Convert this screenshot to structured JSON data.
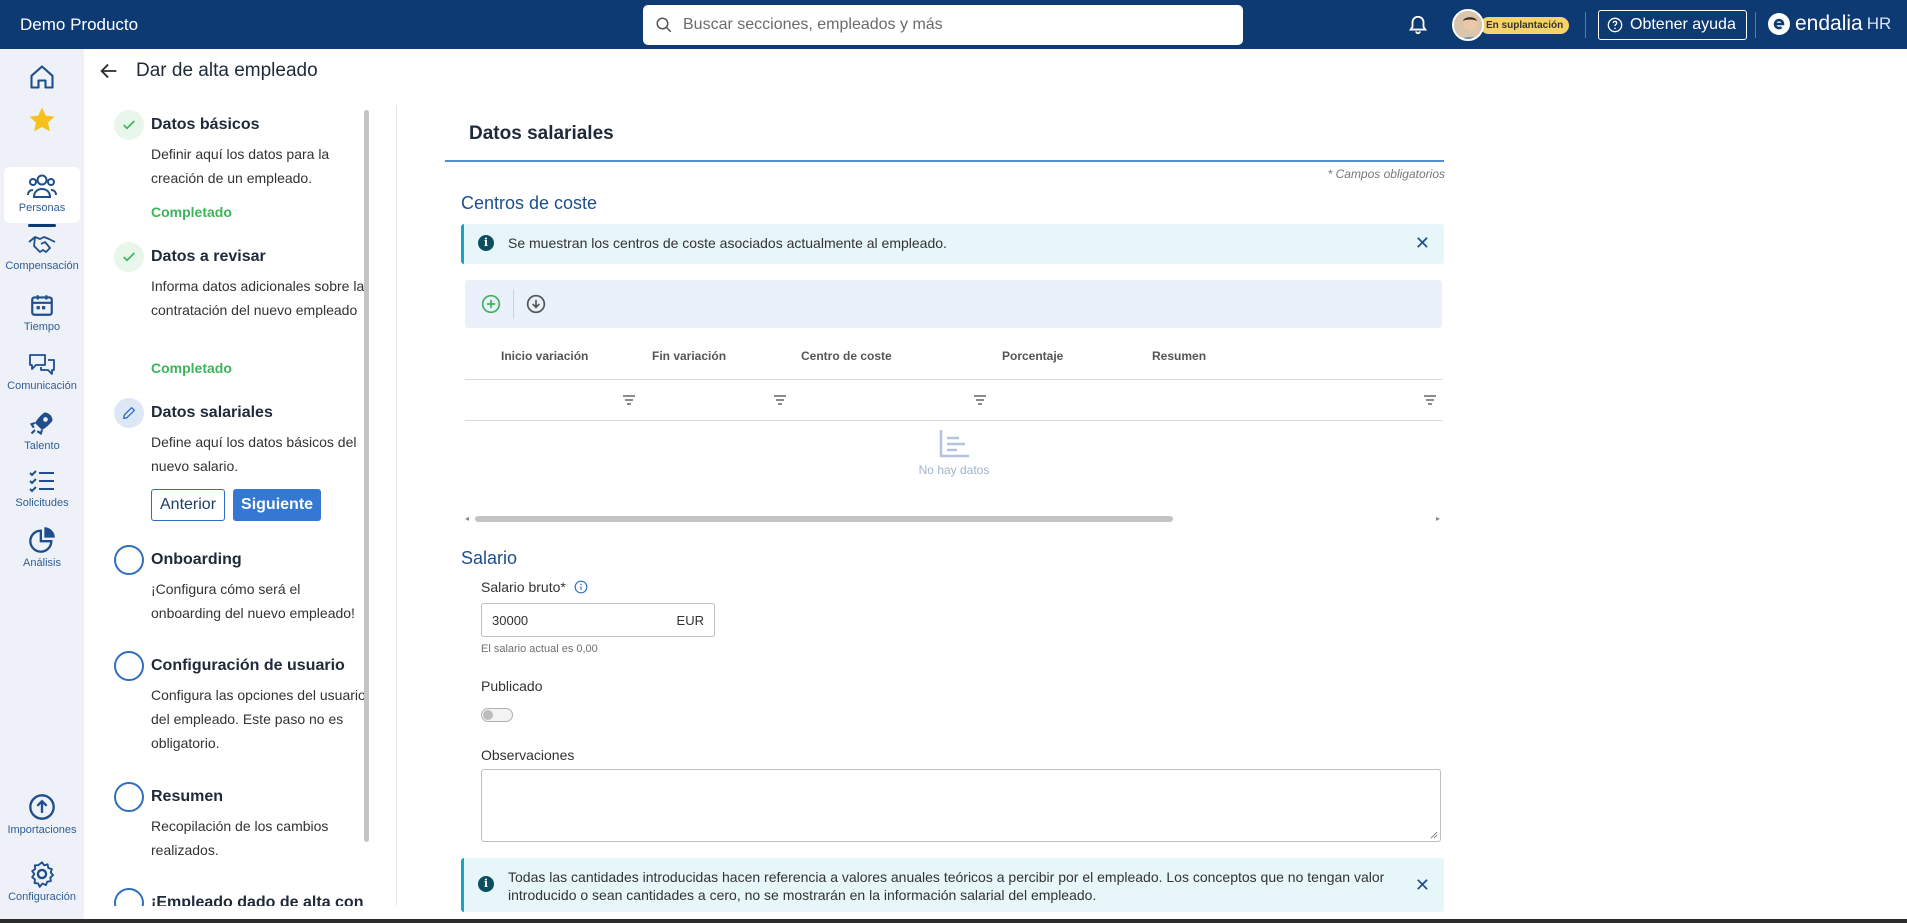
{
  "app": {
    "title": "Demo Producto"
  },
  "search": {
    "placeholder": "Buscar secciones, empleados y más"
  },
  "header": {
    "impersonation_badge": "En suplantación",
    "help_label": "Obtener ayuda",
    "brand_name": "endalia",
    "brand_suffix": "HR"
  },
  "rail": {
    "items": [
      {
        "label": "Personas"
      },
      {
        "label": "Compensación"
      },
      {
        "label": "Tiempo"
      },
      {
        "label": "Comunicación"
      },
      {
        "label": "Talento"
      },
      {
        "label": "Solicitudes"
      },
      {
        "label": "Análisis"
      }
    ],
    "bottom": [
      {
        "label": "Importaciones"
      },
      {
        "label": "Configuración"
      }
    ]
  },
  "page": {
    "title": "Dar de alta empleado"
  },
  "steps": [
    {
      "title": "Datos básicos",
      "desc": "Definir aquí los datos para la creación de un empleado.",
      "status": "Completado"
    },
    {
      "title": "Datos a revisar",
      "desc": "Informa datos adicionales sobre la contratación del nuevo empleado",
      "status": "Completado"
    },
    {
      "title": "Datos salariales",
      "desc": "Define aquí los datos básicos del nuevo salario.",
      "prev_label": "Anterior",
      "next_label": "Siguiente"
    },
    {
      "title": "Onboarding",
      "desc": "¡Configura cómo será el onboarding del nuevo empleado!"
    },
    {
      "title": "Configuración de usuario",
      "desc": "Configura las opciones del usuario del empleado. Este paso no es obligatorio."
    },
    {
      "title": "Resumen",
      "desc": "Recopilación de los cambios realizados."
    },
    {
      "title": "¡Empleado dado de alta con"
    }
  ],
  "main": {
    "section_title": "Datos salariales",
    "required_note": "* Campos obligatorios",
    "cost_centers": {
      "title": "Centros de coste",
      "info": "Se muestran los centros de coste asociados actualmente al empleado.",
      "columns": [
        "Inicio variación",
        "Fin variación",
        "Centro de coste",
        "Porcentaje",
        "Resumen"
      ],
      "empty_text": "No hay datos"
    },
    "salary": {
      "title": "Salario",
      "gross_label": "Salario bruto*",
      "gross_value": "30000",
      "currency": "EUR",
      "current_hint": "El salario actual es 0,00",
      "published_label": "Publicado",
      "published_on": false,
      "notes_label": "Observaciones",
      "notes_value": "",
      "bottom_info": "Todas las cantidades introducidas hacen referencia a valores anuales teóricos a percibir por el empleado. Los conceptos que no tengan valor introducido o sean cantidades a cero, no se mostrarán en la información salarial del empleado."
    }
  },
  "colors": {
    "topbar": "#0e3a73",
    "accent": "#3578d4",
    "success": "#3cb55a",
    "info_bg": "#e6f6f9"
  }
}
